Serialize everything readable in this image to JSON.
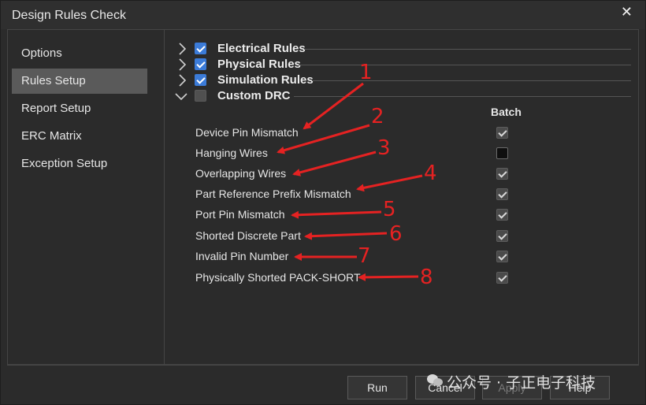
{
  "window": {
    "title": "Design Rules Check",
    "close_glyph": "✕"
  },
  "sidebar": {
    "items": [
      {
        "label": "Options",
        "active": false
      },
      {
        "label": "Rules Setup",
        "active": true
      },
      {
        "label": "Report Setup",
        "active": false
      },
      {
        "label": "ERC Matrix",
        "active": false
      },
      {
        "label": "Exception Setup",
        "active": false
      }
    ]
  },
  "categories": [
    {
      "label": "Electrical Rules",
      "checked": true,
      "expanded": false
    },
    {
      "label": "Physical Rules",
      "checked": true,
      "expanded": false
    },
    {
      "label": "Simulation Rules",
      "checked": true,
      "expanded": false
    },
    {
      "label": "Custom DRC",
      "checked": false,
      "expanded": true
    }
  ],
  "batch_header": "Batch",
  "rules": [
    {
      "label": "Device Pin Mismatch",
      "batch": true,
      "annotation": "1"
    },
    {
      "label": "Hanging Wires",
      "batch": false,
      "annotation": "2"
    },
    {
      "label": "Overlapping Wires",
      "batch": true,
      "annotation": "3"
    },
    {
      "label": "Part Reference Prefix Mismatch",
      "batch": true,
      "annotation": "4"
    },
    {
      "label": "Port Pin Mismatch",
      "batch": true,
      "annotation": "5"
    },
    {
      "label": "Shorted Discrete Part",
      "batch": true,
      "annotation": "6"
    },
    {
      "label": "Invalid Pin Number",
      "batch": true,
      "annotation": "7"
    },
    {
      "label": "Physically Shorted PACK-SHORT",
      "batch": true,
      "annotation": "8"
    }
  ],
  "buttons": {
    "run": "Run",
    "cancel": "Cancel",
    "apply": "Apply",
    "help": "Help"
  },
  "watermark": "公众号 · 子正电子科技",
  "colors": {
    "annotation": "#e52222",
    "checkbox_accent": "#3b7bd8",
    "background": "#2b2b2b"
  }
}
